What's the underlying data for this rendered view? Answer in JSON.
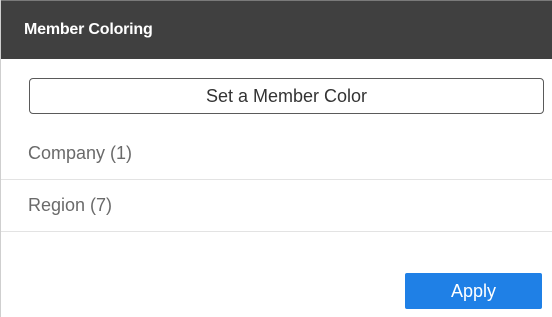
{
  "panel": {
    "title": "Member Coloring",
    "set_color_label": "Set a Member Color",
    "members": [
      {
        "label": "Company (1)"
      },
      {
        "label": "Region (7)"
      }
    ],
    "apply_label": "Apply"
  },
  "colors": {
    "header_bg": "#404040",
    "apply_bg": "#1f80e6",
    "row_divider": "#e3e3e3"
  }
}
